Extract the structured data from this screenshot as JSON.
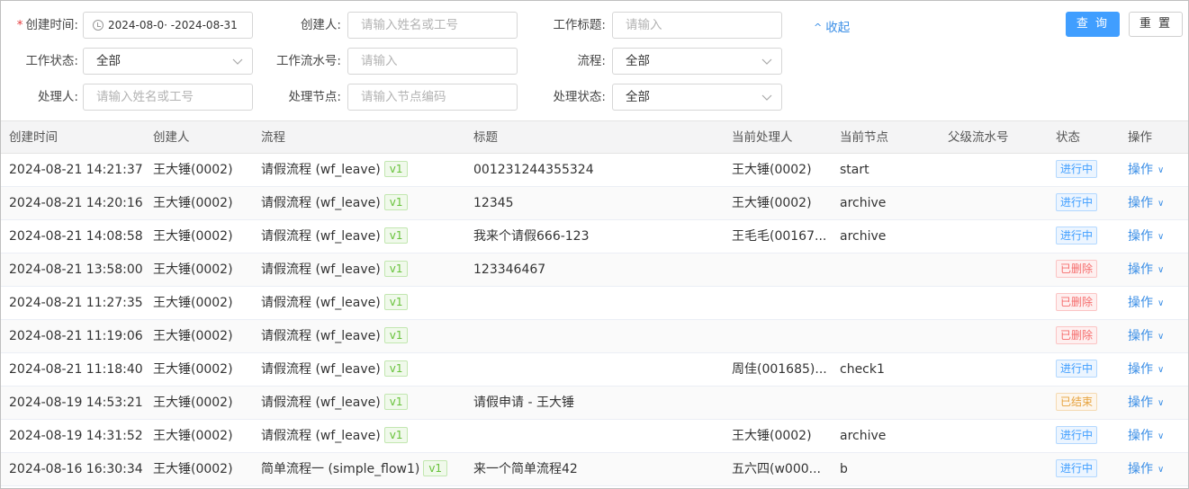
{
  "search": {
    "created_time": {
      "label": "创建时间:",
      "required_mark": "*",
      "value": "2024-08-0· -2024-08-31"
    },
    "creator": {
      "label": "创建人:",
      "placeholder": "请输入姓名或工号"
    },
    "work_title": {
      "label": "工作标题:",
      "placeholder": "请输入"
    },
    "collapse_label": "收起",
    "query_button": "查 询",
    "reset_button": "重 置",
    "work_status": {
      "label": "工作状态:",
      "value": "全部"
    },
    "work_serial": {
      "label": "工作流水号:",
      "placeholder": "请输入"
    },
    "flow": {
      "label": "流程:",
      "value": "全部"
    },
    "handler": {
      "label": "处理人:",
      "placeholder": "请输入姓名或工号"
    },
    "handle_node": {
      "label": "处理节点:",
      "placeholder": "请输入节点编码"
    },
    "handle_status": {
      "label": "处理状态:",
      "value": "全部"
    }
  },
  "table": {
    "columns": [
      "创建时间",
      "创建人",
      "流程",
      "标题",
      "当前处理人",
      "当前节点",
      "父级流水号",
      "状态",
      "操作"
    ],
    "status_colors": {
      "进行中": {
        "color": "#409eff",
        "bg": "#ecf5ff",
        "border": "#b3d8ff"
      },
      "已删除": {
        "color": "#f56c6c",
        "bg": "#fef0f0",
        "border": "#fbc4c4"
      },
      "已结束": {
        "color": "#e6a23c",
        "bg": "#fdf6ec",
        "border": "#f5dab1"
      }
    },
    "action_label": "操作",
    "rows": [
      {
        "time": "2024-08-21 14:21:37",
        "creator": "王大锤(0002)",
        "flow": "请假流程 (wf_leave)",
        "version": "v1",
        "title": "001231244355324",
        "handler": "王大锤(0002)",
        "node": "start",
        "parent": "",
        "status": "进行中"
      },
      {
        "time": "2024-08-21 14:20:16",
        "creator": "王大锤(0002)",
        "flow": "请假流程 (wf_leave)",
        "version": "v1",
        "title": "12345",
        "handler": "王大锤(0002)",
        "node": "archive",
        "parent": "",
        "status": "进行中"
      },
      {
        "time": "2024-08-21 14:08:58",
        "creator": "王大锤(0002)",
        "flow": "请假流程 (wf_leave)",
        "version": "v1",
        "title": "我来个请假666-123",
        "handler": "王毛毛(00167...",
        "node": "archive",
        "parent": "",
        "status": "进行中"
      },
      {
        "time": "2024-08-21 13:58:00",
        "creator": "王大锤(0002)",
        "flow": "请假流程 (wf_leave)",
        "version": "v1",
        "title": "123346467",
        "handler": "",
        "node": "",
        "parent": "",
        "status": "已删除"
      },
      {
        "time": "2024-08-21 11:27:35",
        "creator": "王大锤(0002)",
        "flow": "请假流程 (wf_leave)",
        "version": "v1",
        "title": "",
        "handler": "",
        "node": "",
        "parent": "",
        "status": "已删除"
      },
      {
        "time": "2024-08-21 11:19:06",
        "creator": "王大锤(0002)",
        "flow": "请假流程 (wf_leave)",
        "version": "v1",
        "title": "",
        "handler": "",
        "node": "",
        "parent": "",
        "status": "已删除"
      },
      {
        "time": "2024-08-21 11:18:40",
        "creator": "王大锤(0002)",
        "flow": "请假流程 (wf_leave)",
        "version": "v1",
        "title": "",
        "handler": "周佳(001685)...",
        "node": "check1",
        "parent": "",
        "status": "进行中"
      },
      {
        "time": "2024-08-19 14:53:21",
        "creator": "王大锤(0002)",
        "flow": "请假流程 (wf_leave)",
        "version": "v1",
        "title": "请假申请 - 王大锤",
        "handler": "",
        "node": "",
        "parent": "",
        "status": "已结束"
      },
      {
        "time": "2024-08-19 14:31:52",
        "creator": "王大锤(0002)",
        "flow": "请假流程 (wf_leave)",
        "version": "v1",
        "title": "",
        "handler": "王大锤(0002)",
        "node": "archive",
        "parent": "",
        "status": "进行中"
      },
      {
        "time": "2024-08-16 16:30:34",
        "creator": "王大锤(0002)",
        "flow": "简单流程一 (simple_flow1)",
        "version": "v1",
        "title": "来一个简单流程42",
        "handler": "五六四(w000...",
        "node": "b",
        "parent": "",
        "status": "进行中"
      }
    ]
  }
}
